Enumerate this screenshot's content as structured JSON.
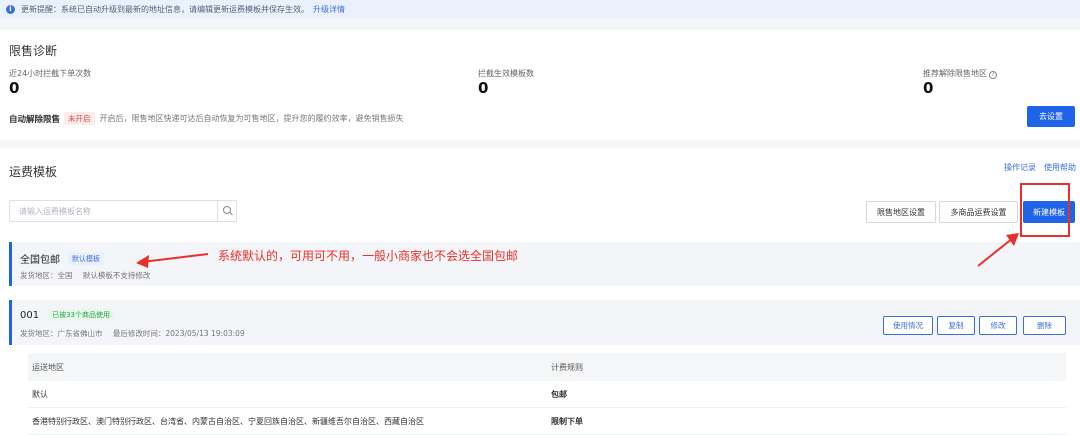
{
  "notice": {
    "text": "更新提醒：系统已自动升级到最新的地址信息，请编辑更新运费模板并保存生效。",
    "link": "升级详情",
    "icon": "info-icon"
  },
  "diagnosis": {
    "title": "限售诊断",
    "stats": [
      {
        "label": "近24小时拦截下单次数",
        "value": "0"
      },
      {
        "label": "拦截生效模板数",
        "value": "0"
      },
      {
        "label": "推荐解除限售地区",
        "value": "0"
      }
    ],
    "auto_label": "自动解除限售",
    "auto_status": "未开启",
    "auto_desc": "开启后，限售地区快递可达后自动恢复为可售地区，提升您的履约效率，避免销售损失",
    "setup_button": "去设置"
  },
  "templates": {
    "title": "运费模板",
    "links": [
      "操作记录",
      "使用帮助"
    ],
    "search_placeholder": "请输入运费模板名称",
    "buttons": {
      "restricted_area": "限售地区设置",
      "multi_product": "多商品运费设置",
      "new_template": "新建模板"
    },
    "national": {
      "name": "全国包邮",
      "tag": "默认模板",
      "origin": "发货地区：全国",
      "note": "默认模板不支持修改"
    },
    "tpl_001": {
      "name": "001",
      "tag": "已被33个商品使用",
      "origin": "发货地区：广东省佛山市",
      "modified": "最后修改时间：2023/05/13 19:03:09",
      "actions": [
        "使用情况",
        "复制",
        "修改",
        "删除"
      ]
    },
    "table": {
      "headers": [
        "运送地区",
        "计费规则"
      ],
      "rows": [
        [
          "默认",
          "包邮"
        ],
        [
          "香港特别行政区、澳门特别行政区、台湾省、内蒙古自治区、宁夏回族自治区、新疆维吾尔自治区、西藏自治区",
          "限制下单"
        ]
      ]
    }
  },
  "annotation": {
    "text": "系统默认的，可用可不用，一般小商家也不会选全国包邮",
    "color": "#e8302a"
  },
  "colors": {
    "primary": "#1f63e8",
    "accent_red": "#e8302a"
  }
}
